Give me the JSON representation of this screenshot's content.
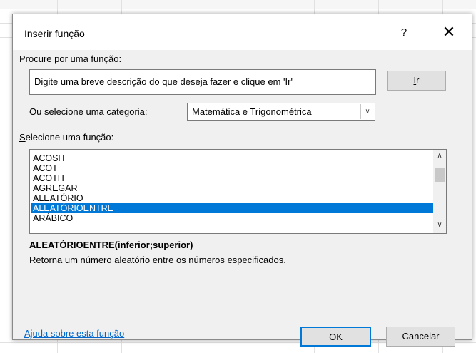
{
  "dialog": {
    "title": "Inserir função",
    "help_label": "?",
    "close_label": "✕",
    "search": {
      "label_prefix": "",
      "label_underlined": "P",
      "label_rest": "rocure por uma função:",
      "value": "Digite uma breve descrição do que deseja fazer e clique em 'Ir'",
      "go_label_underlined": "I",
      "go_label_rest": "r"
    },
    "category": {
      "label_prefix": "Ou selecione uma ",
      "label_underlined": "c",
      "label_rest": "ategoria:",
      "selected": "Matemática e Trigonométrica",
      "arrow": "∨"
    },
    "function_list": {
      "label_prefix": "",
      "label_underlined": "S",
      "label_rest": "elecione uma função:",
      "items": [
        "ACOSH",
        "ACOT",
        "ACOTH",
        "AGREGAR",
        "ALEATÓRIO",
        "ALEATÓRIOENTRE",
        "ARÁBICO"
      ],
      "selected_index": 5,
      "scroll_up": "∧",
      "scroll_down": "∨"
    },
    "selected_function": {
      "signature": "ALEATÓRIOENTRE(inferior;superior)",
      "description": "Retorna um número aleatório entre os números especificados."
    },
    "help_link": "Ajuda sobre esta função",
    "ok_label": "OK",
    "cancel_label": "Cancelar"
  },
  "colors": {
    "accent": "#0078d7",
    "dialog_bg": "#f0f0f0",
    "link": "#0066cc"
  }
}
